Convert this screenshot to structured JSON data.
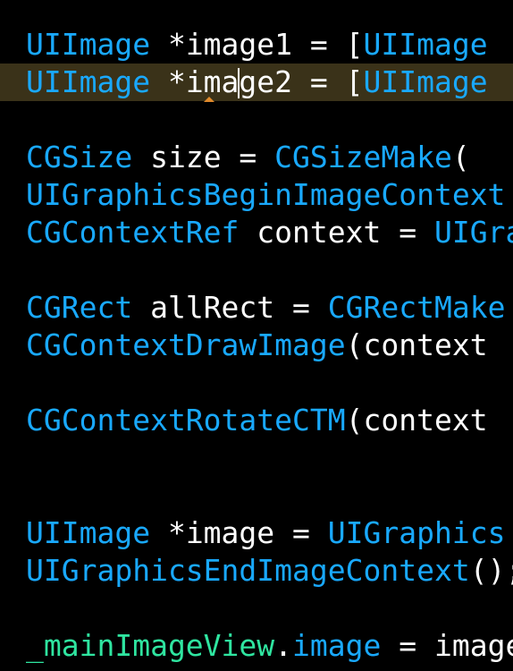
{
  "editor": {
    "current_line_color": "#3a3219",
    "type_color": "#19a9ff",
    "text_color": "#ffffff",
    "property_color": "#2fe5a0",
    "caret_marker_color": "#e08a2c",
    "lines": [
      {
        "t1": "UIImage",
        "t2": " *image1 = [",
        "t3": "UIImage"
      },
      {
        "t1": "UIImage",
        "t2a": " *ima",
        "t2b": "ge2 = [",
        "t3": "UIImage"
      },
      {
        "t1": "CGSize",
        "t2": " size = ",
        "t3": "CGSizeMake",
        "t4": "("
      },
      {
        "t1": "UIGraphicsBeginImageContext"
      },
      {
        "t1": "CGContextRef",
        "t2": " context = ",
        "t3": "UIGraphicsGetCurrentContext"
      },
      {
        "t1": "CGRect",
        "t2": " allRect = ",
        "t3": "CGRectMake"
      },
      {
        "t1": "CGContextDrawImage",
        "t2": "(context"
      },
      {
        "t1": "CGContextRotateCTM",
        "t2": "(context"
      },
      {
        "t1": "UIImage",
        "t2": " *image = ",
        "t3": "UIGraphics"
      },
      {
        "t1": "UIGraphicsEndImageContext",
        "t2": "();"
      },
      {
        "t1": "_mainImageView",
        "t2": ".",
        "t3": "image",
        "t4": " = image"
      }
    ]
  }
}
